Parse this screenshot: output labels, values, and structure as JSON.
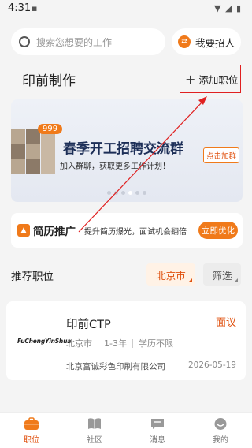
{
  "status_bar": {
    "time": "4:31"
  },
  "search": {
    "placeholder": "搜索您想要的工作"
  },
  "header": {
    "recruit_label": "我要招人",
    "page_title": "印前制作",
    "add_position_label": "添加职位"
  },
  "banner": {
    "badge": "999",
    "title": "春季开工招聘交流群",
    "subtitle": "加入群聊，获取更多工作计划！",
    "join_label": "点击加群"
  },
  "promo": {
    "title": "简历推广",
    "text": "提升简历爆光，面试机会翻倍",
    "button_label": "立即优化"
  },
  "list_header": {
    "label": "推荐职位",
    "city": "北京市",
    "filter": "筛选"
  },
  "job": {
    "logo_text": "FuChengYinShua",
    "title": "印前CTP",
    "salary": "面议",
    "tags": [
      "北京市",
      "1-3年",
      "学历不限"
    ],
    "company": "北京富诚彩色印刷有限公司",
    "date": "2026-05-19"
  },
  "tabs": [
    {
      "label": "职位",
      "icon": "briefcase-icon",
      "active": true
    },
    {
      "label": "社区",
      "icon": "book-icon",
      "active": false
    },
    {
      "label": "消息",
      "icon": "chat-icon",
      "active": false
    },
    {
      "label": "我的",
      "icon": "profile-icon",
      "active": false
    }
  ],
  "colors": {
    "accent": "#f07a1a",
    "accent_text": "#e0510f",
    "annotation": "#e02020"
  }
}
